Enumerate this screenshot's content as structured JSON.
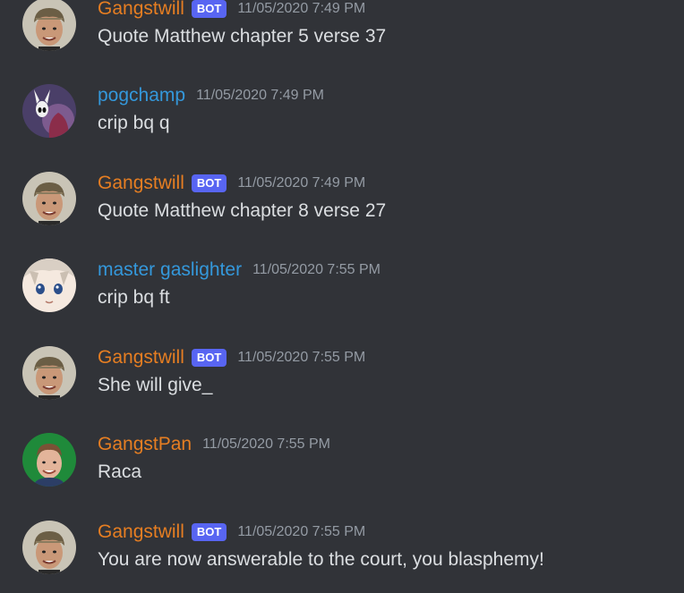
{
  "colors": {
    "background": "#313338",
    "bot_name": "#e67e22",
    "blue_name": "#3498db",
    "timestamp": "#949ba4",
    "text": "#dbdee1",
    "bot_badge": "#5865f2"
  },
  "messages": [
    {
      "author": "Gangstwill",
      "bot": true,
      "badge": "BOT",
      "timestamp": "11/05/2020 7:49 PM",
      "text": "Quote Matthew chapter 5 verse 37",
      "avatar": "gangstwill-avatar",
      "name_color": "#e67e22"
    },
    {
      "author": "pogchamp",
      "bot": false,
      "badge": "",
      "timestamp": "11/05/2020 7:49 PM",
      "text": "crip bq q",
      "avatar": "hollow-knight-avatar",
      "name_color": "#3498db"
    },
    {
      "author": "Gangstwill",
      "bot": true,
      "badge": "BOT",
      "timestamp": "11/05/2020 7:49 PM",
      "text": "Quote Matthew chapter 8 verse 27",
      "avatar": "gangstwill-avatar",
      "name_color": "#e67e22"
    },
    {
      "author": "master gaslighter",
      "bot": false,
      "badge": "",
      "timestamp": "11/05/2020 7:55 PM",
      "text": "crip bq ft",
      "avatar": "anime-face-avatar",
      "name_color": "#3498db"
    },
    {
      "author": "Gangstwill",
      "bot": true,
      "badge": "BOT",
      "timestamp": "11/05/2020 7:55 PM",
      "text": "She will give_",
      "avatar": "gangstwill-avatar",
      "name_color": "#e67e22"
    },
    {
      "author": "GangstPan",
      "bot": false,
      "badge": "",
      "timestamp": "11/05/2020 7:55 PM",
      "text": "Raca",
      "avatar": "gangstpan-avatar",
      "name_color": "#e67e22"
    },
    {
      "author": "Gangstwill",
      "bot": true,
      "badge": "BOT",
      "timestamp": "11/05/2020 7:55 PM",
      "text": "You are now answerable to the court, you blasphemy!",
      "avatar": "gangstwill-avatar",
      "name_color": "#e67e22"
    }
  ]
}
